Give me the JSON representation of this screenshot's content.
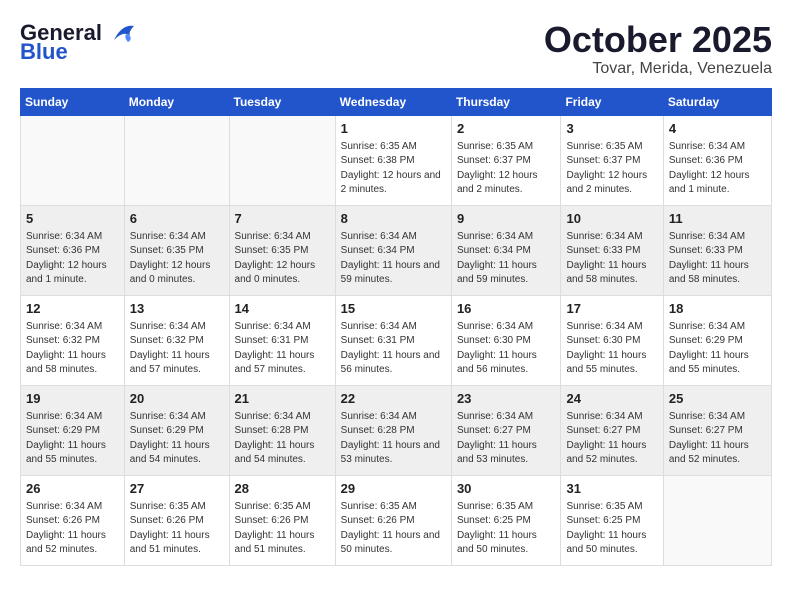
{
  "logo": {
    "line1": "General",
    "line2": "Blue",
    "tagline": ""
  },
  "title": "October 2025",
  "subtitle": "Tovar, Merida, Venezuela",
  "days_of_week": [
    "Sunday",
    "Monday",
    "Tuesday",
    "Wednesday",
    "Thursday",
    "Friday",
    "Saturday"
  ],
  "weeks": [
    [
      {
        "day": "",
        "sunrise": "",
        "sunset": "",
        "daylight": ""
      },
      {
        "day": "",
        "sunrise": "",
        "sunset": "",
        "daylight": ""
      },
      {
        "day": "",
        "sunrise": "",
        "sunset": "",
        "daylight": ""
      },
      {
        "day": "1",
        "sunrise": "Sunrise: 6:35 AM",
        "sunset": "Sunset: 6:38 PM",
        "daylight": "Daylight: 12 hours and 2 minutes."
      },
      {
        "day": "2",
        "sunrise": "Sunrise: 6:35 AM",
        "sunset": "Sunset: 6:37 PM",
        "daylight": "Daylight: 12 hours and 2 minutes."
      },
      {
        "day": "3",
        "sunrise": "Sunrise: 6:35 AM",
        "sunset": "Sunset: 6:37 PM",
        "daylight": "Daylight: 12 hours and 2 minutes."
      },
      {
        "day": "4",
        "sunrise": "Sunrise: 6:34 AM",
        "sunset": "Sunset: 6:36 PM",
        "daylight": "Daylight: 12 hours and 1 minute."
      }
    ],
    [
      {
        "day": "5",
        "sunrise": "Sunrise: 6:34 AM",
        "sunset": "Sunset: 6:36 PM",
        "daylight": "Daylight: 12 hours and 1 minute."
      },
      {
        "day": "6",
        "sunrise": "Sunrise: 6:34 AM",
        "sunset": "Sunset: 6:35 PM",
        "daylight": "Daylight: 12 hours and 0 minutes."
      },
      {
        "day": "7",
        "sunrise": "Sunrise: 6:34 AM",
        "sunset": "Sunset: 6:35 PM",
        "daylight": "Daylight: 12 hours and 0 minutes."
      },
      {
        "day": "8",
        "sunrise": "Sunrise: 6:34 AM",
        "sunset": "Sunset: 6:34 PM",
        "daylight": "Daylight: 11 hours and 59 minutes."
      },
      {
        "day": "9",
        "sunrise": "Sunrise: 6:34 AM",
        "sunset": "Sunset: 6:34 PM",
        "daylight": "Daylight: 11 hours and 59 minutes."
      },
      {
        "day": "10",
        "sunrise": "Sunrise: 6:34 AM",
        "sunset": "Sunset: 6:33 PM",
        "daylight": "Daylight: 11 hours and 58 minutes."
      },
      {
        "day": "11",
        "sunrise": "Sunrise: 6:34 AM",
        "sunset": "Sunset: 6:33 PM",
        "daylight": "Daylight: 11 hours and 58 minutes."
      }
    ],
    [
      {
        "day": "12",
        "sunrise": "Sunrise: 6:34 AM",
        "sunset": "Sunset: 6:32 PM",
        "daylight": "Daylight: 11 hours and 58 minutes."
      },
      {
        "day": "13",
        "sunrise": "Sunrise: 6:34 AM",
        "sunset": "Sunset: 6:32 PM",
        "daylight": "Daylight: 11 hours and 57 minutes."
      },
      {
        "day": "14",
        "sunrise": "Sunrise: 6:34 AM",
        "sunset": "Sunset: 6:31 PM",
        "daylight": "Daylight: 11 hours and 57 minutes."
      },
      {
        "day": "15",
        "sunrise": "Sunrise: 6:34 AM",
        "sunset": "Sunset: 6:31 PM",
        "daylight": "Daylight: 11 hours and 56 minutes."
      },
      {
        "day": "16",
        "sunrise": "Sunrise: 6:34 AM",
        "sunset": "Sunset: 6:30 PM",
        "daylight": "Daylight: 11 hours and 56 minutes."
      },
      {
        "day": "17",
        "sunrise": "Sunrise: 6:34 AM",
        "sunset": "Sunset: 6:30 PM",
        "daylight": "Daylight: 11 hours and 55 minutes."
      },
      {
        "day": "18",
        "sunrise": "Sunrise: 6:34 AM",
        "sunset": "Sunset: 6:29 PM",
        "daylight": "Daylight: 11 hours and 55 minutes."
      }
    ],
    [
      {
        "day": "19",
        "sunrise": "Sunrise: 6:34 AM",
        "sunset": "Sunset: 6:29 PM",
        "daylight": "Daylight: 11 hours and 55 minutes."
      },
      {
        "day": "20",
        "sunrise": "Sunrise: 6:34 AM",
        "sunset": "Sunset: 6:29 PM",
        "daylight": "Daylight: 11 hours and 54 minutes."
      },
      {
        "day": "21",
        "sunrise": "Sunrise: 6:34 AM",
        "sunset": "Sunset: 6:28 PM",
        "daylight": "Daylight: 11 hours and 54 minutes."
      },
      {
        "day": "22",
        "sunrise": "Sunrise: 6:34 AM",
        "sunset": "Sunset: 6:28 PM",
        "daylight": "Daylight: 11 hours and 53 minutes."
      },
      {
        "day": "23",
        "sunrise": "Sunrise: 6:34 AM",
        "sunset": "Sunset: 6:27 PM",
        "daylight": "Daylight: 11 hours and 53 minutes."
      },
      {
        "day": "24",
        "sunrise": "Sunrise: 6:34 AM",
        "sunset": "Sunset: 6:27 PM",
        "daylight": "Daylight: 11 hours and 52 minutes."
      },
      {
        "day": "25",
        "sunrise": "Sunrise: 6:34 AM",
        "sunset": "Sunset: 6:27 PM",
        "daylight": "Daylight: 11 hours and 52 minutes."
      }
    ],
    [
      {
        "day": "26",
        "sunrise": "Sunrise: 6:34 AM",
        "sunset": "Sunset: 6:26 PM",
        "daylight": "Daylight: 11 hours and 52 minutes."
      },
      {
        "day": "27",
        "sunrise": "Sunrise: 6:35 AM",
        "sunset": "Sunset: 6:26 PM",
        "daylight": "Daylight: 11 hours and 51 minutes."
      },
      {
        "day": "28",
        "sunrise": "Sunrise: 6:35 AM",
        "sunset": "Sunset: 6:26 PM",
        "daylight": "Daylight: 11 hours and 51 minutes."
      },
      {
        "day": "29",
        "sunrise": "Sunrise: 6:35 AM",
        "sunset": "Sunset: 6:26 PM",
        "daylight": "Daylight: 11 hours and 50 minutes."
      },
      {
        "day": "30",
        "sunrise": "Sunrise: 6:35 AM",
        "sunset": "Sunset: 6:25 PM",
        "daylight": "Daylight: 11 hours and 50 minutes."
      },
      {
        "day": "31",
        "sunrise": "Sunrise: 6:35 AM",
        "sunset": "Sunset: 6:25 PM",
        "daylight": "Daylight: 11 hours and 50 minutes."
      },
      {
        "day": "",
        "sunrise": "",
        "sunset": "",
        "daylight": ""
      }
    ]
  ],
  "colors": {
    "header_bg": "#2255cc",
    "header_text": "#ffffff",
    "row_even": "#efefef",
    "row_odd": "#ffffff"
  }
}
